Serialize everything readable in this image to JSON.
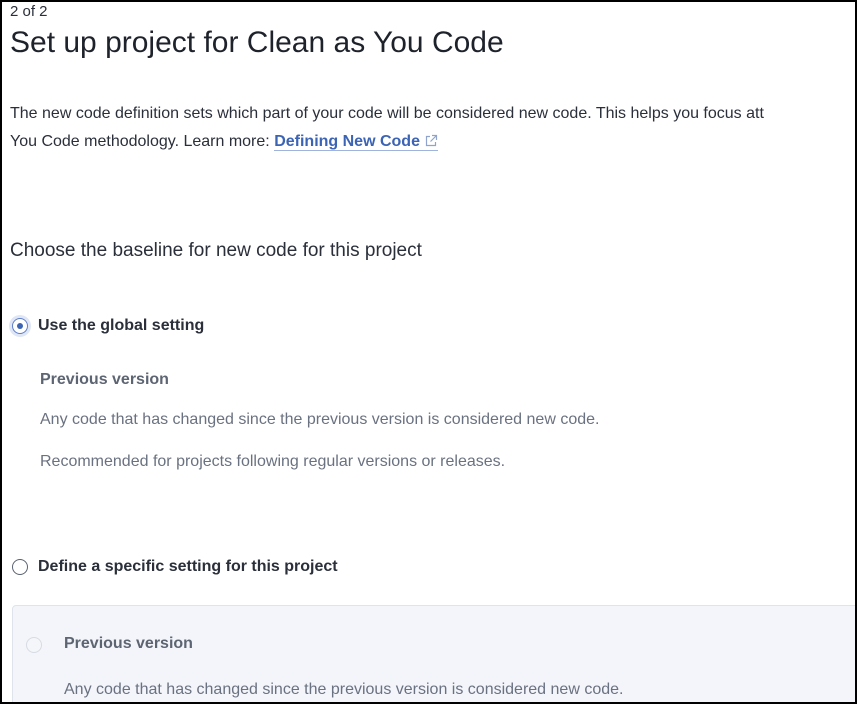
{
  "step_indicator": "2 of 2",
  "page_title": "Set up project for Clean as You Code",
  "description": {
    "line1": "The new code definition sets which part of your code will be considered new code. This helps you focus att",
    "line2_prefix": "You Code methodology. Learn more:",
    "link_label": "Defining New Code"
  },
  "section_heading": "Choose the baseline for new code for this project",
  "global_option": {
    "label": "Use the global setting",
    "selected": true,
    "sub_title": "Previous version",
    "text_1": "Any code that has changed since the previous version is considered new code.",
    "text_2": "Recommended for projects following regular versions or releases."
  },
  "specific_option": {
    "label": "Define a specific setting for this project",
    "selected": false,
    "sub_option": {
      "label": "Previous version",
      "text": "Any code that has changed since the previous version is considered new code."
    }
  },
  "icons": {
    "link": "external-link-icon"
  },
  "colors": {
    "link": "#3c64b4",
    "radio_selected": "#3c64b4",
    "panel_background": "#f3f5fa"
  }
}
